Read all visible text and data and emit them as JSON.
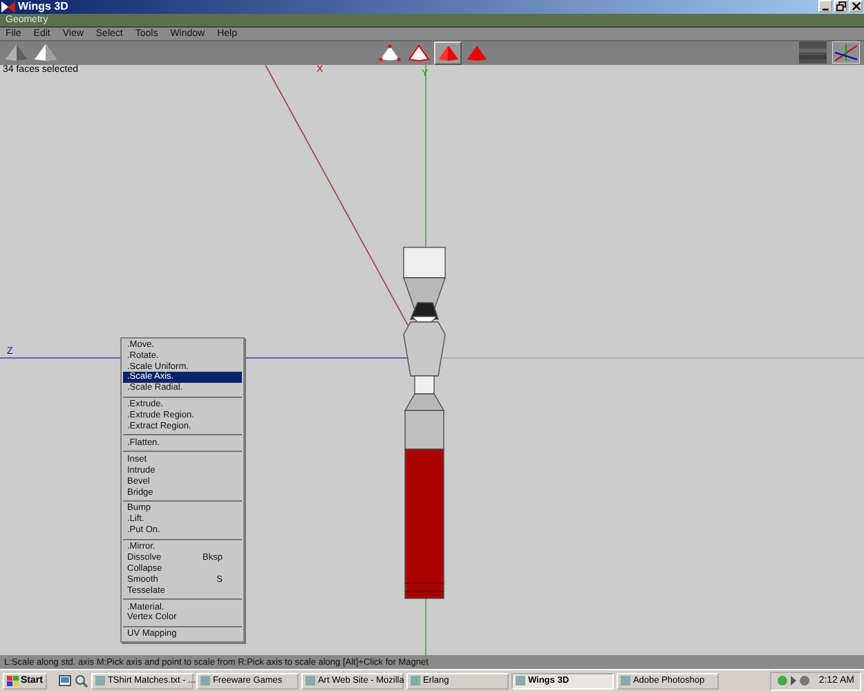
{
  "window": {
    "title": "Wings 3D"
  },
  "geometry_bar": {
    "title": "Geometry"
  },
  "menu_bar": [
    "File",
    "Edit",
    "View",
    "Select",
    "Tools",
    "Window",
    "Help"
  ],
  "toolbar": {
    "selection_modes": [
      {
        "kind": "vertex",
        "selected": false
      },
      {
        "kind": "edge",
        "selected": false
      },
      {
        "kind": "face",
        "selected": true
      },
      {
        "kind": "body",
        "selected": false
      }
    ]
  },
  "viewport": {
    "info": "34 faces selected",
    "axis_labels": [
      {
        "kind": "x",
        "text": "X"
      },
      {
        "kind": "y",
        "text": "Y"
      },
      {
        "kind": "z",
        "text": "Z"
      }
    ]
  },
  "context_menu": {
    "groups": [
      [
        {
          "label": ".Move.",
          "selected": false
        },
        {
          "label": ".Rotate.",
          "selected": false
        },
        {
          "label": ".Scale Uniform.",
          "selected": false
        },
        {
          "label": ".Scale Axis.",
          "selected": true
        },
        {
          "label": ".Scale Radial.",
          "selected": false
        }
      ],
      [
        {
          "label": ".Extrude.",
          "selected": false
        },
        {
          "label": ".Extrude Region.",
          "selected": false
        },
        {
          "label": ".Extract Region.",
          "selected": false
        }
      ],
      [
        {
          "label": ".Flatten.",
          "selected": false
        }
      ],
      [
        {
          "label": "Inset",
          "selected": false
        },
        {
          "label": "Intrude",
          "selected": false
        },
        {
          "label": "Bevel",
          "selected": false
        },
        {
          "label": "Bridge",
          "selected": false
        }
      ],
      [
        {
          "label": "Bump",
          "selected": false
        },
        {
          "label": ".Lift.",
          "selected": false
        },
        {
          "label": ".Put On.",
          "selected": false
        }
      ],
      [
        {
          "label": ".Mirror.",
          "selected": false
        },
        {
          "label": "Dissolve",
          "shortcut": "Bksp",
          "selected": false
        },
        {
          "label": "Collapse",
          "selected": false
        },
        {
          "label": "Smooth",
          "shortcut": "S",
          "selected": false
        },
        {
          "label": "Tesselate",
          "selected": false
        }
      ],
      [
        {
          "label": ".Material.",
          "selected": false
        },
        {
          "label": "Vertex Color",
          "selected": false
        }
      ],
      [
        {
          "label": "UV Mapping",
          "selected": false
        }
      ]
    ]
  },
  "status_line": "L:Scale along std. axis   M:Pick axis and point to scale from   R:Pick axis to scale along   [Alt]+Click for Magnet",
  "taskbar": {
    "start": "Start",
    "tasks": [
      {
        "label": "TShirt Matches.txt - ...",
        "selected": false
      },
      {
        "label": "Freeware Games",
        "selected": false
      },
      {
        "label": "Art Web Site - Mozilla",
        "selected": false
      },
      {
        "label": "Erlang",
        "selected": false
      },
      {
        "label": "Wings 3D",
        "selected": true
      },
      {
        "label": "Adobe Photoshop",
        "selected": false
      }
    ],
    "clock": "2:12 AM"
  }
}
